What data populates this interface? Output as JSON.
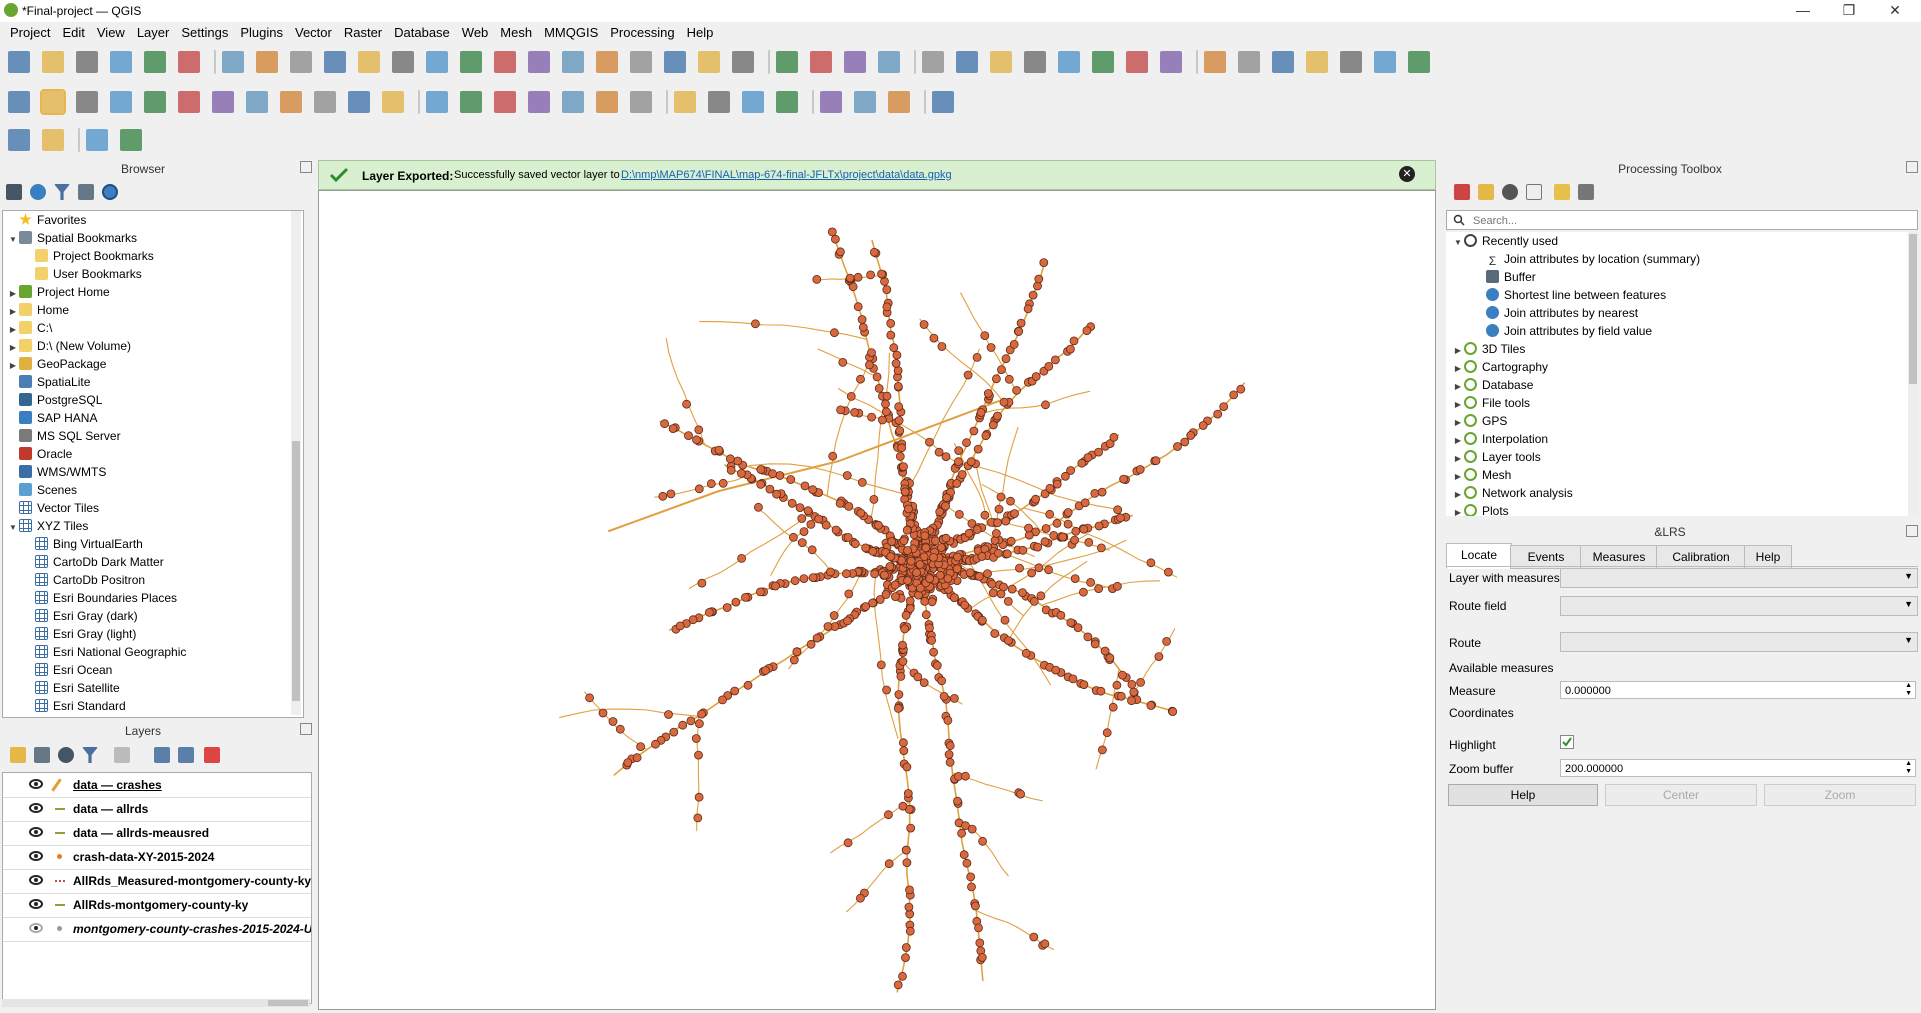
{
  "window": {
    "title": "*Final-project — QGIS"
  },
  "menu": [
    "Project",
    "Edit",
    "View",
    "Layer",
    "Settings",
    "Plugins",
    "Vector",
    "Raster",
    "Database",
    "Web",
    "Mesh",
    "MMQGIS",
    "Processing",
    "Help"
  ],
  "browser": {
    "title": "Browser",
    "items": [
      {
        "label": "Favorites",
        "indent": 0,
        "arrow": "",
        "icon": "star"
      },
      {
        "label": "Spatial Bookmarks",
        "indent": 0,
        "arrow": "▼",
        "icon": "bookmark"
      },
      {
        "label": "Project Bookmarks",
        "indent": 1,
        "arrow": "",
        "icon": "folder"
      },
      {
        "label": "User Bookmarks",
        "indent": 1,
        "arrow": "",
        "icon": "folder"
      },
      {
        "label": "Project Home",
        "indent": 0,
        "arrow": "▶",
        "icon": "home"
      },
      {
        "label": "Home",
        "indent": 0,
        "arrow": "▶",
        "icon": "folder"
      },
      {
        "label": "C:\\",
        "indent": 0,
        "arrow": "▶",
        "icon": "folder"
      },
      {
        "label": "D:\\ (New Volume)",
        "indent": 0,
        "arrow": "▶",
        "icon": "folder"
      },
      {
        "label": "GeoPackage",
        "indent": 0,
        "arrow": "▶",
        "icon": "geopackage"
      },
      {
        "label": "SpatiaLite",
        "indent": 0,
        "arrow": "",
        "icon": "spatialite"
      },
      {
        "label": "PostgreSQL",
        "indent": 0,
        "arrow": "",
        "icon": "postgres"
      },
      {
        "label": "SAP HANA",
        "indent": 0,
        "arrow": "",
        "icon": "hana"
      },
      {
        "label": "MS SQL Server",
        "indent": 0,
        "arrow": "",
        "icon": "mssql"
      },
      {
        "label": "Oracle",
        "indent": 0,
        "arrow": "",
        "icon": "oracle"
      },
      {
        "label": "WMS/WMTS",
        "indent": 0,
        "arrow": "",
        "icon": "wms"
      },
      {
        "label": "Scenes",
        "indent": 0,
        "arrow": "",
        "icon": "scenes"
      },
      {
        "label": "Vector Tiles",
        "indent": 0,
        "arrow": "",
        "icon": "grid"
      },
      {
        "label": "XYZ Tiles",
        "indent": 0,
        "arrow": "▼",
        "icon": "grid"
      },
      {
        "label": "Bing VirtualEarth",
        "indent": 1,
        "arrow": "",
        "icon": "grid"
      },
      {
        "label": "CartoDb Dark Matter",
        "indent": 1,
        "arrow": "",
        "icon": "grid"
      },
      {
        "label": "CartoDb Positron",
        "indent": 1,
        "arrow": "",
        "icon": "grid"
      },
      {
        "label": "Esri Boundaries Places",
        "indent": 1,
        "arrow": "",
        "icon": "grid"
      },
      {
        "label": "Esri Gray (dark)",
        "indent": 1,
        "arrow": "",
        "icon": "grid"
      },
      {
        "label": "Esri Gray (light)",
        "indent": 1,
        "arrow": "",
        "icon": "grid"
      },
      {
        "label": "Esri National Geographic",
        "indent": 1,
        "arrow": "",
        "icon": "grid"
      },
      {
        "label": "Esri Ocean",
        "indent": 1,
        "arrow": "",
        "icon": "grid"
      },
      {
        "label": "Esri Satellite",
        "indent": 1,
        "arrow": "",
        "icon": "grid"
      },
      {
        "label": "Esri Standard",
        "indent": 1,
        "arrow": "",
        "icon": "grid"
      }
    ]
  },
  "layers": {
    "title": "Layers",
    "items": [
      {
        "label": "data — crashes",
        "symbol": "pencil",
        "italic": false,
        "visible": true,
        "underline": true
      },
      {
        "label": "data — allrds",
        "symbol": "line-olive",
        "italic": false,
        "visible": true,
        "underline": false
      },
      {
        "label": "data — allrds-meausred",
        "symbol": "line-olive",
        "italic": false,
        "visible": true,
        "underline": false
      },
      {
        "label": "crash-data-XY-2015-2024",
        "symbol": "point-orange",
        "italic": false,
        "visible": true,
        "underline": false
      },
      {
        "label": "AllRds_Measured-montgomery-county-ky",
        "symbol": "line-dotted-red",
        "italic": false,
        "visible": true,
        "underline": false
      },
      {
        "label": "AllRds-montgomery-county-ky",
        "symbol": "line-olive",
        "italic": false,
        "visible": true,
        "underline": false
      },
      {
        "label": "montgomery-county-crashes-2015-2024-U",
        "symbol": "point-grey",
        "italic": true,
        "visible": false,
        "underline": false
      }
    ]
  },
  "message_bar": {
    "title": "Layer Exported:",
    "text": "Successfully saved vector layer to",
    "link": "D:\\nmp\\MAP674\\FINAL\\map-674-final-JFLTx\\project\\data\\data.gpkg"
  },
  "processing": {
    "title": "Processing Toolbox",
    "search_placeholder": "Search...",
    "items": [
      {
        "label": "Recently used",
        "indent": 0,
        "arrow": "▼",
        "icon": "clock"
      },
      {
        "label": "Join attributes by location (summary)",
        "indent": 1,
        "arrow": "",
        "icon": "sigma"
      },
      {
        "label": "Buffer",
        "indent": 1,
        "arrow": "",
        "icon": "buffer"
      },
      {
        "label": "Shortest line between features",
        "indent": 1,
        "arrow": "",
        "icon": "gear"
      },
      {
        "label": "Join attributes by nearest",
        "indent": 1,
        "arrow": "",
        "icon": "gear"
      },
      {
        "label": "Join attributes by field value",
        "indent": 1,
        "arrow": "",
        "icon": "gear"
      },
      {
        "label": "3D Tiles",
        "indent": 0,
        "arrow": "▶",
        "icon": "qgis"
      },
      {
        "label": "Cartography",
        "indent": 0,
        "arrow": "▶",
        "icon": "qgis"
      },
      {
        "label": "Database",
        "indent": 0,
        "arrow": "▶",
        "icon": "qgis"
      },
      {
        "label": "File tools",
        "indent": 0,
        "arrow": "▶",
        "icon": "qgis"
      },
      {
        "label": "GPS",
        "indent": 0,
        "arrow": "▶",
        "icon": "qgis"
      },
      {
        "label": "Interpolation",
        "indent": 0,
        "arrow": "▶",
        "icon": "qgis"
      },
      {
        "label": "Layer tools",
        "indent": 0,
        "arrow": "▶",
        "icon": "qgis"
      },
      {
        "label": "Mesh",
        "indent": 0,
        "arrow": "▶",
        "icon": "qgis"
      },
      {
        "label": "Network analysis",
        "indent": 0,
        "arrow": "▶",
        "icon": "qgis"
      },
      {
        "label": "Plots",
        "indent": 0,
        "arrow": "▶",
        "icon": "qgis"
      }
    ]
  },
  "lrs": {
    "title": "&LRS",
    "tabs": [
      "Locate",
      "Events",
      "Measures",
      "Calibration",
      "Help"
    ],
    "active_tab": "Locate",
    "labels": {
      "layer_with_measures": "Layer with measures",
      "route_field": "Route field",
      "route": "Route",
      "available_measures": "Available measures",
      "measure": "Measure",
      "coordinates": "Coordinates",
      "highlight": "Highlight",
      "zoom_buffer": "Zoom buffer"
    },
    "measure_value": "0.000000",
    "zoom_buffer_value": "200.000000",
    "highlight_checked": true,
    "buttons": {
      "help": "Help",
      "center": "Center",
      "zoom": "Zoom"
    }
  },
  "colors": {
    "crash_point": "#d9683f",
    "crash_outline": "#5a2a18",
    "road": "#e0a040",
    "message_bg": "#d9f0d0",
    "check_green": "#2e8b2e"
  }
}
